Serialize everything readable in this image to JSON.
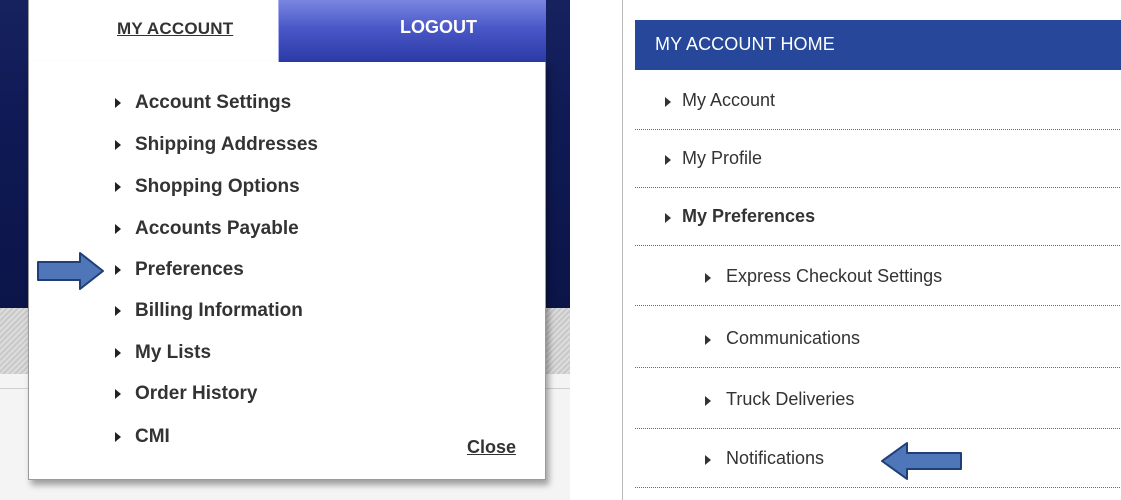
{
  "left_menu": {
    "account_tab_label": "MY ACCOUNT",
    "logout_label": "LOGOUT",
    "items": [
      {
        "label": "Account Settings"
      },
      {
        "label": "Shipping Addresses"
      },
      {
        "label": "Shopping Options"
      },
      {
        "label": "Accounts Payable"
      },
      {
        "label": "Preferences"
      },
      {
        "label": "Billing Information"
      },
      {
        "label": "My Lists"
      },
      {
        "label": "Order History"
      },
      {
        "label": "CMI"
      }
    ],
    "close_label": "Close",
    "highlighted_item": "Preferences"
  },
  "right_panel": {
    "header_title": "MY ACCOUNT HOME",
    "items": [
      {
        "label": "My Account"
      },
      {
        "label": "My Profile"
      },
      {
        "label": "My Preferences"
      },
      {
        "label": "Express Checkout Settings"
      },
      {
        "label": "Communications"
      },
      {
        "label": "Truck Deliveries"
      },
      {
        "label": "Notifications"
      }
    ],
    "highlighted_item": "Notifications"
  },
  "colors": {
    "header_blue": "#27489a",
    "arrow_fill": "#4f76b8",
    "arrow_stroke": "#1f3f77",
    "logout_tab": "#4a58c8"
  }
}
